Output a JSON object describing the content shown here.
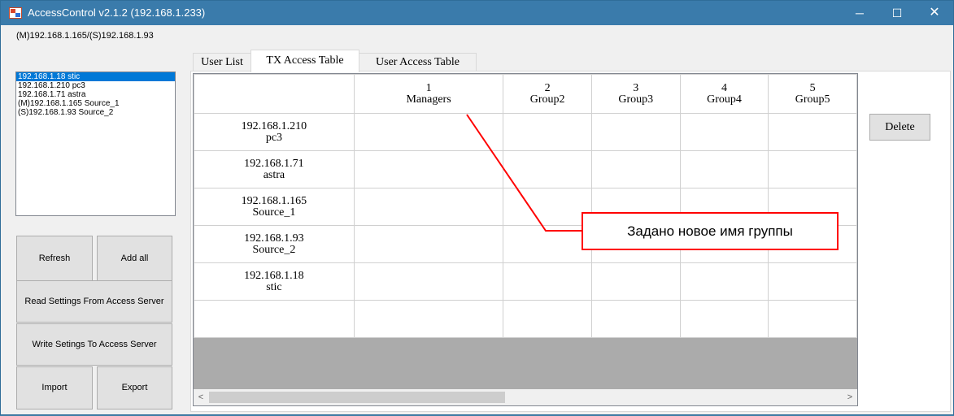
{
  "window": {
    "title": "AccessControl v2.1.2 (192.168.1.233)",
    "minimize_glyph": "─",
    "maximize_glyph": "☐",
    "close_glyph": "✕"
  },
  "left_panel": {
    "server_label": "(M)192.168.1.165/(S)192.168.1.93",
    "devices": [
      "192.168.1.18 stic",
      "192.168.1.210 pc3",
      "192.168.1.71 astra",
      "(M)192.168.1.165 Source_1",
      "(S)192.168.1.93 Source_2"
    ],
    "selected_device_index": 0,
    "buttons": {
      "refresh": "Refresh",
      "add_all": "Add all",
      "read_settings": "Read Settings From Access Server",
      "write_settings": "Write Setings To Access Server",
      "import": "Import",
      "export": "Export"
    }
  },
  "tabs": [
    {
      "label": "User List",
      "active": false
    },
    {
      "label": "TX Access Table",
      "active": true
    },
    {
      "label": "User Access Table",
      "active": false
    }
  ],
  "grid": {
    "columns": [
      {
        "number": "1",
        "name": "Managers"
      },
      {
        "number": "2",
        "name": "Group2"
      },
      {
        "number": "3",
        "name": "Group3"
      },
      {
        "number": "4",
        "name": "Group4"
      },
      {
        "number": "5",
        "name": "Group5"
      }
    ],
    "rows": [
      {
        "ip": "192.168.1.210",
        "name": "pc3"
      },
      {
        "ip": "192.168.1.71",
        "name": "astra"
      },
      {
        "ip": "192.168.1.165",
        "name": "Source_1"
      },
      {
        "ip": "192.168.1.93",
        "name": "Source_2"
      },
      {
        "ip": "192.168.1.18",
        "name": "stic"
      },
      {
        "ip": "",
        "name": ""
      }
    ],
    "scroll_left_glyph": "<",
    "scroll_right_glyph": ">"
  },
  "delete_label": "Delete",
  "annotation": {
    "text": "Задано новое имя группы",
    "color": "#ff0000"
  },
  "colors": {
    "titlebar": "#3a7bab",
    "selection": "#0078d7",
    "grid_empty_area": "#ababab"
  }
}
